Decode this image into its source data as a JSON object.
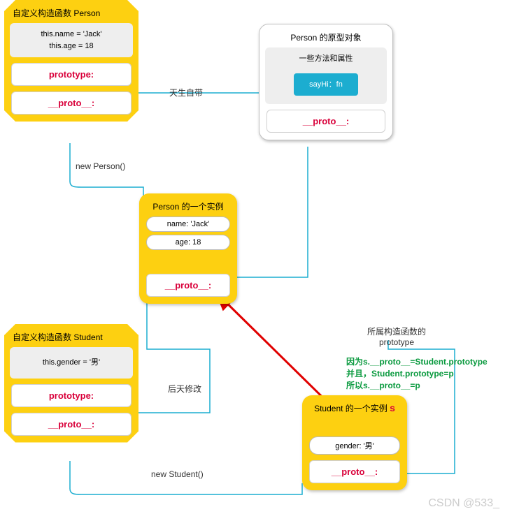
{
  "personCtor": {
    "title": "自定义构造函数 Person",
    "body_line1": "this.name = 'Jack'",
    "body_line2": "this.age = 18",
    "slot1": "prototype:",
    "slot2": "__proto__:"
  },
  "personProto": {
    "title": "Person  的原型对象",
    "subtitle": "一些方法和属性",
    "method": "sayHi：fn",
    "slot": "__proto__:"
  },
  "personInstance": {
    "title": "Person 的一个实例",
    "field1": "name: 'Jack'",
    "field2": "age: 18",
    "slot": "__proto__:"
  },
  "studentCtor": {
    "title": "自定义构造函数 Student",
    "body_line1": "this.gender = '男'",
    "slot1": "prototype:",
    "slot2": "__proto__:"
  },
  "studentInstance": {
    "title": "Student 的一个实例 ",
    "title_suffix": "s",
    "field1": "gender: '男'",
    "slot": "__proto__:"
  },
  "labels": {
    "born_with": "天生自带",
    "new_person": "new Person()",
    "later_modify": "后天修改",
    "new_student": "new Student()",
    "belongs": "所属构造函数的",
    "belongs2": "prototype"
  },
  "explain": {
    "l1": "因为s.__proto__=Student.prototype",
    "l2": "并且，Student.prototype=p",
    "l3": "所以s.__proto__=p"
  },
  "watermark": "CSDN @533_"
}
